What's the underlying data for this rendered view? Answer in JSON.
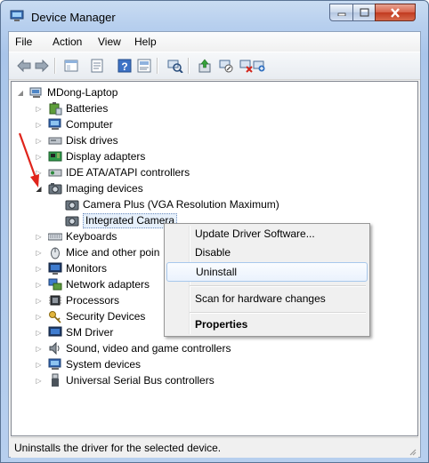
{
  "window": {
    "title": "Device Manager"
  },
  "menu": [
    "File",
    "Action",
    "View",
    "Help"
  ],
  "toolbar": [
    "back-icon",
    "forward-icon",
    "show-hide-console-tree-icon",
    "properties-icon",
    "help-icon",
    "scan-hardware-icon",
    "update-driver-icon",
    "disable-device-icon",
    "uninstall-device-icon"
  ],
  "tree": {
    "root": "MDong-Laptop",
    "items": [
      {
        "label": "Batteries",
        "icon": "battery-icon"
      },
      {
        "label": "Computer",
        "icon": "computer-icon"
      },
      {
        "label": "Disk drives",
        "icon": "disk-drive-icon"
      },
      {
        "label": "Display adapters",
        "icon": "display-adapter-icon"
      },
      {
        "label": "IDE ATA/ATAPI controllers",
        "icon": "ide-controller-icon"
      },
      {
        "label": "Imaging devices",
        "icon": "camera-icon",
        "expanded": true,
        "children": [
          {
            "label": "Camera Plus (VGA Resolution Maximum)"
          },
          {
            "label": "Integrated Camera",
            "selected": true
          }
        ]
      },
      {
        "label": "Keyboards",
        "icon": "keyboard-icon"
      },
      {
        "label": "Mice and other poin",
        "icon": "mouse-icon"
      },
      {
        "label": "Monitors",
        "icon": "monitor-icon"
      },
      {
        "label": "Network adapters",
        "icon": "network-adapter-icon"
      },
      {
        "label": "Processors",
        "icon": "processor-icon"
      },
      {
        "label": "Security Devices",
        "icon": "security-key-icon"
      },
      {
        "label": "SM Driver",
        "icon": "sm-driver-icon"
      },
      {
        "label": "Sound, video and game controllers",
        "icon": "speaker-icon"
      },
      {
        "label": "System devices",
        "icon": "system-devices-icon"
      },
      {
        "label": "Universal Serial Bus controllers",
        "icon": "usb-icon"
      }
    ]
  },
  "context_menu": {
    "items": [
      {
        "label": "Update Driver Software..."
      },
      {
        "label": "Disable"
      },
      {
        "label": "Uninstall",
        "highlighted": true
      },
      {
        "label": "Scan for hardware changes"
      },
      {
        "label": "Properties",
        "bold": true
      }
    ]
  },
  "status": "Uninstalls the driver for the selected device.",
  "colors": {
    "annotation_arrow": "#e0241b",
    "titlebar": "#b9d1ee"
  }
}
